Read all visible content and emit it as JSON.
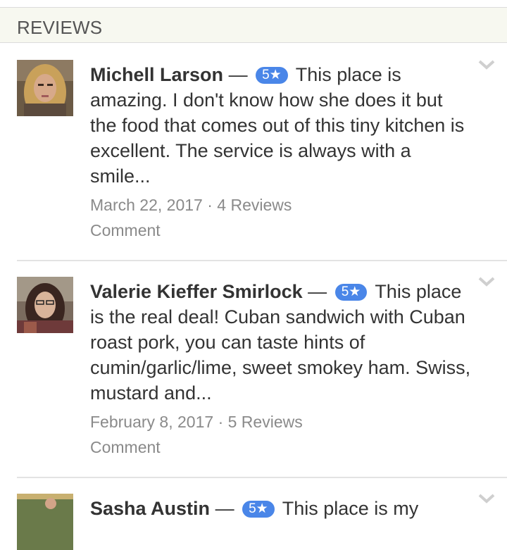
{
  "section": {
    "title": "REVIEWS"
  },
  "reviews": [
    {
      "author": "Michell Larson",
      "dash": "—",
      "rating": "5★",
      "text": "This place is amazing. I don't know how she does it but the food that comes out of this tiny kitchen is excellent. The service is always with a smile...",
      "date": "March 22, 2017",
      "separator": "·",
      "review_count": "4 Reviews",
      "comment_label": "Comment"
    },
    {
      "author": "Valerie Kieffer Smirlock",
      "dash": "—",
      "rating": "5★",
      "text": "This place is the real deal! Cuban sandwich with Cuban roast pork, you can taste hints of cumin/garlic/lime, sweet smokey ham. Swiss, mustard and...",
      "date": "February 8, 2017",
      "separator": "·",
      "review_count": "5 Reviews",
      "comment_label": "Comment"
    },
    {
      "author": "Sasha Austin",
      "dash": "—",
      "rating": "5★",
      "text": "This place is my"
    }
  ],
  "colors": {
    "badge": "#4a86e8",
    "header_bg": "#f7f8f0"
  },
  "icons": {
    "expand": "chevron-down-icon"
  }
}
